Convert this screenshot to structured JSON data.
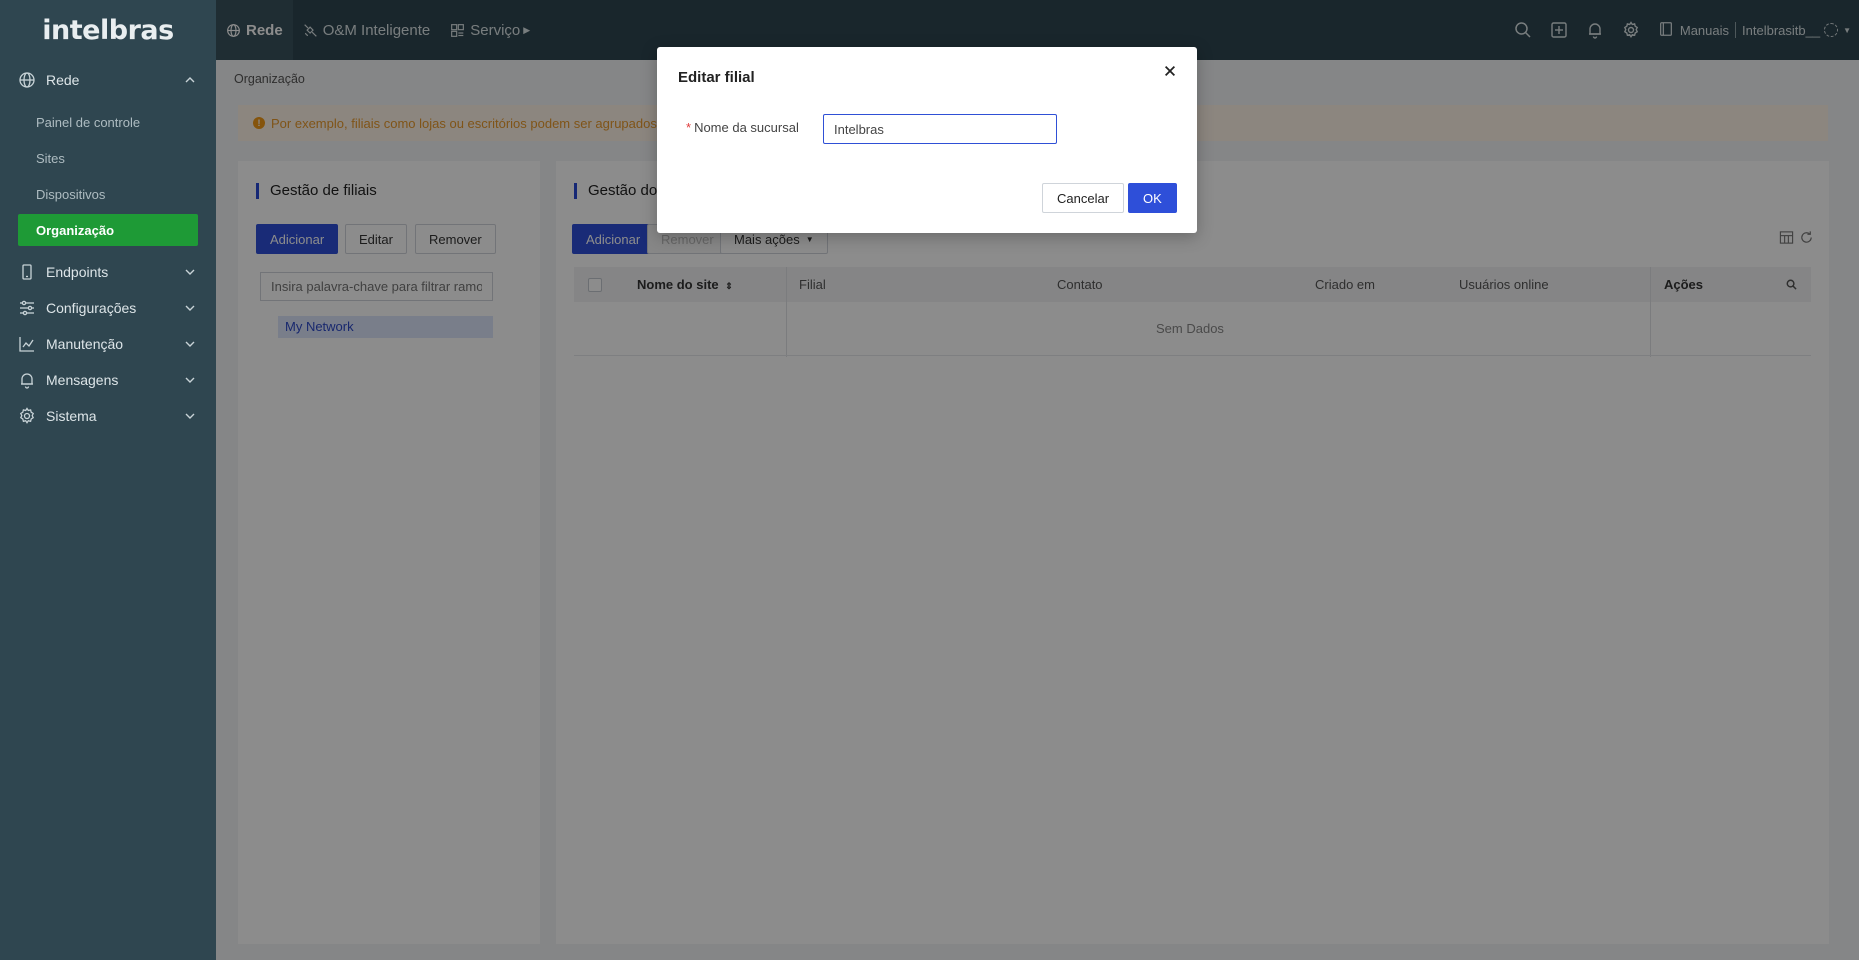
{
  "brand": {
    "logo_text": "intelbras"
  },
  "sidebar": {
    "items": [
      {
        "label": "Rede",
        "icon": "globe-icon",
        "expanded": true,
        "children": [
          "Painel de controle",
          "Sites",
          "Dispositivos",
          "Organização"
        ],
        "active_child": "Organização"
      },
      {
        "label": "Endpoints",
        "icon": "device-icon"
      },
      {
        "label": "Configurações",
        "icon": "sliders-icon"
      },
      {
        "label": "Manutenção",
        "icon": "chart-icon"
      },
      {
        "label": "Mensagens",
        "icon": "bell-icon"
      },
      {
        "label": "Sistema",
        "icon": "gear-icon"
      }
    ]
  },
  "topbar": {
    "tabs": [
      {
        "label": "Rede",
        "icon": "globe-icon",
        "active": true
      },
      {
        "label": "O&M Inteligente",
        "icon": "satellite-icon"
      },
      {
        "label": "Serviço",
        "icon": "service-icon"
      }
    ],
    "manuals_label": "Manuais",
    "user_label": "Intelbrasitb__"
  },
  "main": {
    "breadcrumb": "Organização",
    "hint": "Por exemplo, filiais como lojas ou escritórios podem ser agrupados po",
    "left_panel": {
      "title": "Gestão de filiais",
      "buttons": {
        "add": "Adicionar",
        "edit": "Editar",
        "remove": "Remover"
      },
      "search_placeholder": "Insira palavra-chave para filtrar ramos",
      "tree_node": "My Network"
    },
    "right_panel": {
      "title": "Gestão do",
      "buttons": {
        "add": "Adicionar",
        "remove": "Remover",
        "more": "Mais ações"
      },
      "columns": [
        "Nome do site",
        "Filial",
        "Contato",
        "Criado em",
        "Usuários online",
        "Ações"
      ],
      "empty_text": "Sem Dados"
    }
  },
  "modal": {
    "title": "Editar filial",
    "field_label": "Nome da sucursal",
    "field_value": "Intelbras",
    "cancel": "Cancelar",
    "ok": "OK"
  },
  "colors": {
    "sidebar_bg": "#2f4650",
    "active_green": "#1e9a36",
    "primary_blue": "#2e4fd9",
    "hint_text": "#e99a2c"
  }
}
